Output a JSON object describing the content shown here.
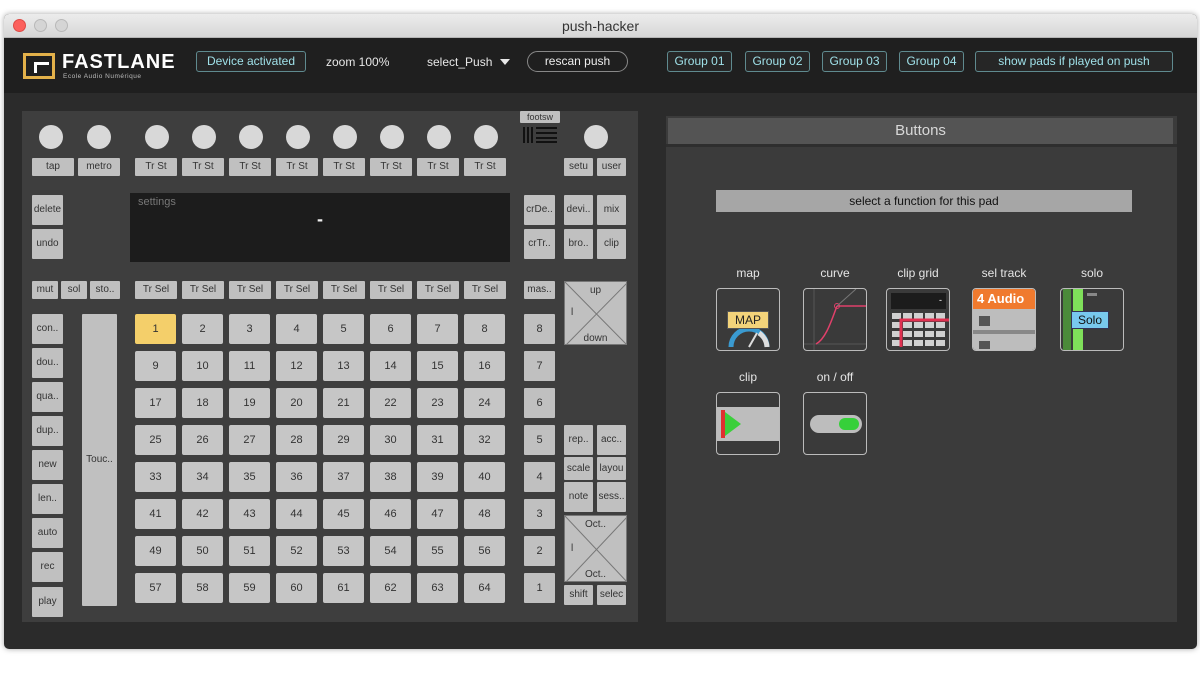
{
  "window": {
    "title": "push-hacker"
  },
  "topbar": {
    "logo_name": "FASTLANE",
    "logo_sub": "Ecole Audio Numérique",
    "device_status": "Device activated",
    "zoom": "zoom 100%",
    "select_device": "select_Push",
    "rescan": "rescan push",
    "groups": [
      "Group 01",
      "Group 02",
      "Group 03",
      "Group 04"
    ],
    "show_pads": "show pads if played on push"
  },
  "push": {
    "footswitch": "footsw",
    "tap": "tap",
    "metro": "metro",
    "track_stop": [
      "Tr St",
      "Tr St",
      "Tr St",
      "Tr St",
      "Tr St",
      "Tr St",
      "Tr St",
      "Tr St"
    ],
    "setup": "setu",
    "user": "user",
    "delete": "delete",
    "undo": "undo",
    "display_label": "settings",
    "display_value": "-",
    "create_device": "crDe..",
    "create_track": "crTr..",
    "device": "devi..",
    "mix": "mix",
    "browse": "bro..",
    "clip": "clip",
    "mute": "mut",
    "solo": "sol",
    "stop": "sto..",
    "track_select": [
      "Tr Sel",
      "Tr Sel",
      "Tr Sel",
      "Tr Sel",
      "Tr Sel",
      "Tr Sel",
      "Tr Sel",
      "Tr Sel"
    ],
    "master": "mas..",
    "nav_up": "up",
    "nav_mid": "l",
    "nav_down": "down",
    "left_buttons": [
      "con..",
      "dou..",
      "qua..",
      "dup..",
      "new",
      "len..",
      "auto",
      "rec",
      "play"
    ],
    "touch_strip": "Touc..",
    "pads": [
      "1",
      "2",
      "3",
      "4",
      "5",
      "6",
      "7",
      "8",
      "9",
      "10",
      "11",
      "12",
      "13",
      "14",
      "15",
      "16",
      "17",
      "18",
      "19",
      "20",
      "21",
      "22",
      "23",
      "24",
      "25",
      "26",
      "27",
      "28",
      "29",
      "30",
      "31",
      "32",
      "33",
      "34",
      "35",
      "36",
      "37",
      "38",
      "39",
      "40",
      "41",
      "42",
      "43",
      "44",
      "45",
      "46",
      "47",
      "48",
      "49",
      "50",
      "51",
      "52",
      "53",
      "54",
      "55",
      "56",
      "57",
      "58",
      "59",
      "60",
      "61",
      "62",
      "63",
      "64"
    ],
    "scene_buttons": [
      "8",
      "7",
      "6",
      "5",
      "4",
      "3",
      "2",
      "1"
    ],
    "repeat": "rep..",
    "accent": "acc..",
    "scale": "scale",
    "layout": "layou",
    "note": "note",
    "session": "sess..",
    "oct_up": "Oct..",
    "oct_mid": "l",
    "oct_down": "Oct..",
    "shift": "shift",
    "select": "selec"
  },
  "buttons_panel": {
    "title": "Buttons",
    "select_function": "select a function for this pad",
    "functions": [
      {
        "label": "map",
        "badge": "MAP"
      },
      {
        "label": "curve"
      },
      {
        "label": "clip grid",
        "value": "-"
      },
      {
        "label": "sel track",
        "badge": "4 Audio"
      },
      {
        "label": "solo",
        "badge": "Solo"
      },
      {
        "label": "clip"
      },
      {
        "label": "on / off"
      }
    ]
  },
  "colors": {
    "accent_cyan": "#9fe0e8",
    "selected_pad": "#f4cf6a",
    "map_badge": "#f3d37a",
    "sel_track_orange": "#f07a2e",
    "solo_blue": "#78c8ee",
    "solo_green": "#7fe05a",
    "clip_green": "#3ccf3c",
    "toggle_green": "#36d03a"
  }
}
